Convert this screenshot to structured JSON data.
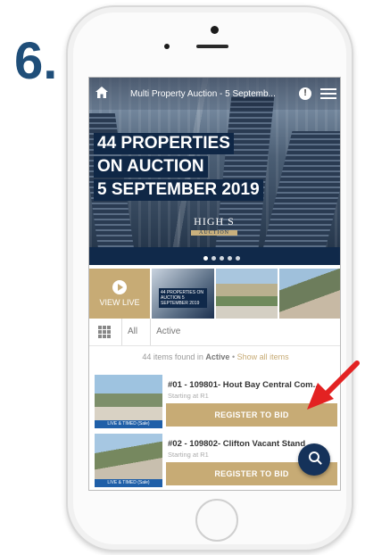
{
  "step": {
    "number": "6."
  },
  "topbar": {
    "title": "Multi Property Auction - 5 Septemb..."
  },
  "hero": {
    "lines": [
      "44 PROPERTIES",
      "ON AUCTION",
      "5 SEPTEMBER 2019"
    ],
    "logo_main": "HIGH S",
    "logo_sub": "AUCTION",
    "slides": 5,
    "active_slide": 1
  },
  "thumbs": {
    "view_live": "VIEW LIVE",
    "mini_caption": "44 PROPERTIES ON AUCTION 5 SEPTEMBER 2019"
  },
  "filter": {
    "all": "All",
    "active": "Active"
  },
  "summary": {
    "prefix": "44 items found in",
    "scope": "Active",
    "sep": "•",
    "show_all": "Show all items"
  },
  "lots": [
    {
      "title": "#01 - 109801- Hout Bay Central Com...",
      "starting": "Starting at R1",
      "badge": "LIVE & TIMED (Sale)",
      "button": "REGISTER TO BID"
    },
    {
      "title": "#02 - 109802- Clifton Vacant Stand",
      "starting": "Starting at R1",
      "badge": "LIVE & TIMED (Sale)",
      "button": "REGISTER TO BID"
    }
  ],
  "colors": {
    "navy": "#10294a",
    "gold": "#c7ab75",
    "step": "#1f4e79",
    "arrow": "#e32222"
  },
  "icons": [
    "home-icon",
    "info-icon",
    "menu-icon",
    "play-icon",
    "grid-icon",
    "search-icon",
    "arrow-icon"
  ]
}
